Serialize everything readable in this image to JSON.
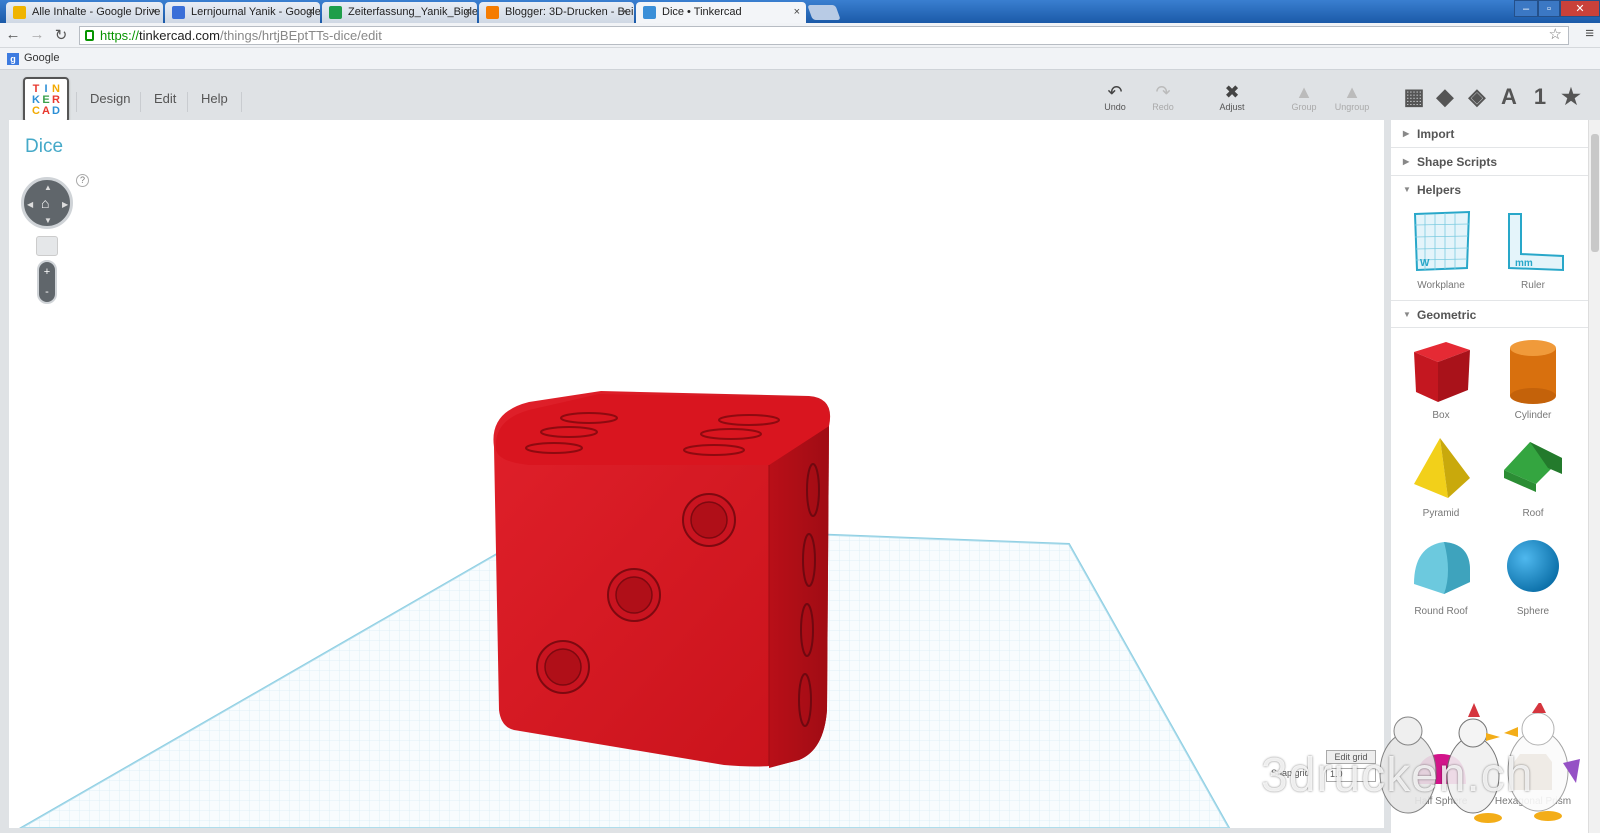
{
  "browser": {
    "tabs": [
      {
        "title": "Alle Inhalte - Google Drive",
        "color": "#f0b400",
        "active": false
      },
      {
        "title": "Lernjournal Yanik - Google",
        "color": "#3a6fd8",
        "active": false
      },
      {
        "title": "Zeiterfassung_Yanik_Bigle",
        "color": "#1e9e4a",
        "active": false
      },
      {
        "title": "Blogger: 3D-Drucken - Bei",
        "color": "#f57c00",
        "active": false
      },
      {
        "title": "Dice • Tinkercad",
        "color": "#3a8fd8",
        "active": true
      }
    ],
    "tab_close": "×",
    "url_scheme": "https://",
    "url_host": "tinkercad.com",
    "url_path": "/things/hrtjBEptTTs-dice/edit",
    "bookmark": "Google"
  },
  "app": {
    "logo_letters": [
      "T",
      "I",
      "N",
      "K",
      "E",
      "R",
      "C",
      "A",
      "D"
    ],
    "menu": [
      "Design",
      "Edit",
      "Help"
    ],
    "tools": {
      "undo": "Undo",
      "redo": "Redo",
      "adjust": "Adjust",
      "group": "Group",
      "ungroup": "Ungroup"
    },
    "view_icons": [
      "workplane-view-icon",
      "cube-solid-icon",
      "cube-wire-icon",
      "text-icon",
      "number-icon",
      "favorites-icon"
    ],
    "view_text": {
      "letter": "A",
      "number": "1",
      "star": "★"
    },
    "design_title": "Dice",
    "help_mark": "?",
    "zoom_plus": "+",
    "zoom_minus": "-",
    "snap_label": "Snap grid",
    "snap_value": "1.0",
    "edit_grid": "Edit grid",
    "watermark": "3drucken.ch",
    "dice_color": "#d8161f",
    "grid_color": "#a9dbea"
  },
  "sidebar": {
    "sections": [
      {
        "label": "Import",
        "expanded": false
      },
      {
        "label": "Shape Scripts",
        "expanded": false
      },
      {
        "label": "Helpers",
        "expanded": true
      },
      {
        "label": "Geometric",
        "expanded": true
      }
    ],
    "helpers": [
      "Workplane",
      "Ruler"
    ],
    "geometric": [
      "Box",
      "Cylinder",
      "Pyramid",
      "Roof",
      "Round Roof",
      "Sphere",
      "Half Sphere",
      "Hexagonal Prism"
    ],
    "shape_colors": {
      "box": "#d01b25",
      "cylinder": "#e07a12",
      "pyramid": "#f2d01a",
      "roof": "#2f9a3a",
      "round_roof": "#5bbfd6",
      "sphere": "#1a8fd0",
      "half_sphere": "#d2148a"
    }
  }
}
